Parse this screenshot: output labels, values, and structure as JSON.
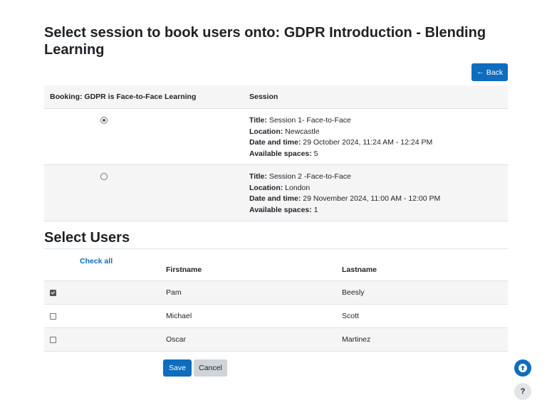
{
  "page": {
    "title": "Select session to book users onto: GDPR Introduction - Blending Learning",
    "back_label": "Back"
  },
  "sessions": {
    "header_booking": "Booking: GDPR is Face-to-Face Learning",
    "header_session": "Session",
    "rows": [
      {
        "selected": true,
        "title_label": "Title:",
        "title": "Session 1- Face-to-Face",
        "location_label": "Location:",
        "location": "Newcastle",
        "datetime_label": "Date and time:",
        "datetime": "29 October 2024, 11:24 AM - 12:24 PM",
        "spaces_label": "Available spaces:",
        "spaces": "5"
      },
      {
        "selected": false,
        "title_label": "Title:",
        "title": "Session 2 -Face-to-Face",
        "location_label": "Location:",
        "location": "London",
        "datetime_label": "Date and time:",
        "datetime": "29 November 2024, 11:00 AM - 12:00 PM",
        "spaces_label": "Available spaces:",
        "spaces": "1"
      }
    ]
  },
  "users": {
    "section_title": "Select Users",
    "check_all_label": "Check all",
    "header_firstname": "Firstname",
    "header_lastname": "Lastname",
    "rows": [
      {
        "checked": true,
        "firstname": "Pam",
        "lastname": "Beesly"
      },
      {
        "checked": false,
        "firstname": "Michael",
        "lastname": "Scott"
      },
      {
        "checked": false,
        "firstname": "Oscar",
        "lastname": "Martinez"
      }
    ]
  },
  "actions": {
    "save_label": "Save",
    "cancel_label": "Cancel"
  },
  "floating": {
    "help_label": "?"
  },
  "icons": {
    "back": "arrow-left-icon",
    "scroll_up": "arrow-up-circle-icon",
    "help": "question-icon"
  },
  "colors": {
    "primary": "#0f6cbf",
    "row_stripe": "#f5f5f5",
    "secondary_button": "#ced4da"
  }
}
